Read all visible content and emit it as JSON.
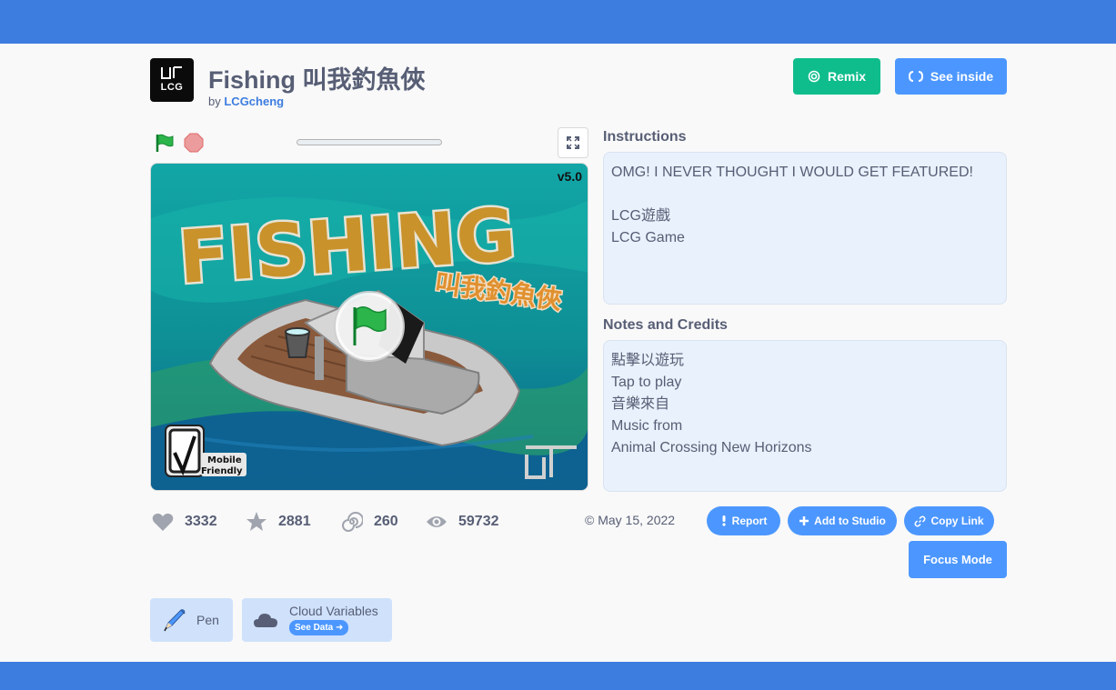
{
  "project": {
    "title": "Fishing 叫我釣魚俠",
    "by_prefix": "by",
    "author": "LCGcheng",
    "logo_text": "LCG"
  },
  "header_buttons": {
    "remix": "Remix",
    "see_inside": "See inside"
  },
  "player": {
    "version": "v5.0",
    "stage_title": "FISHING",
    "stage_subtitle": "叫我釣魚俠",
    "badge_line1": "Mobile",
    "badge_line2": "Friendly"
  },
  "instructions": {
    "heading": "Instructions",
    "lines": [
      "OMG! I NEVER THOUGHT I WOULD GET FEATURED!",
      "",
      "LCG遊戲",
      "LCG Game"
    ]
  },
  "notes": {
    "heading": "Notes and Credits",
    "lines": [
      "點擊以遊玩",
      "Tap to play",
      "音樂來自",
      "Music from",
      "Animal Crossing New Horizons"
    ]
  },
  "stats": {
    "loves": "3332",
    "favorites": "2881",
    "remixes": "260",
    "views": "59732"
  },
  "date": "May 15, 2022",
  "actions": {
    "report": "Report",
    "add_to_studio": "Add to Studio",
    "copy_link": "Copy Link",
    "focus_mode": "Focus Mode"
  },
  "extensions": {
    "pen": "Pen",
    "cloud": "Cloud Variables",
    "see_data": "See Data"
  },
  "colors": {
    "brand_blue": "#3d7de0",
    "remix_green": "#0fbd8c",
    "button_blue": "#4c97ff",
    "text": "#575e75",
    "info_bg": "#e9f1fc"
  }
}
